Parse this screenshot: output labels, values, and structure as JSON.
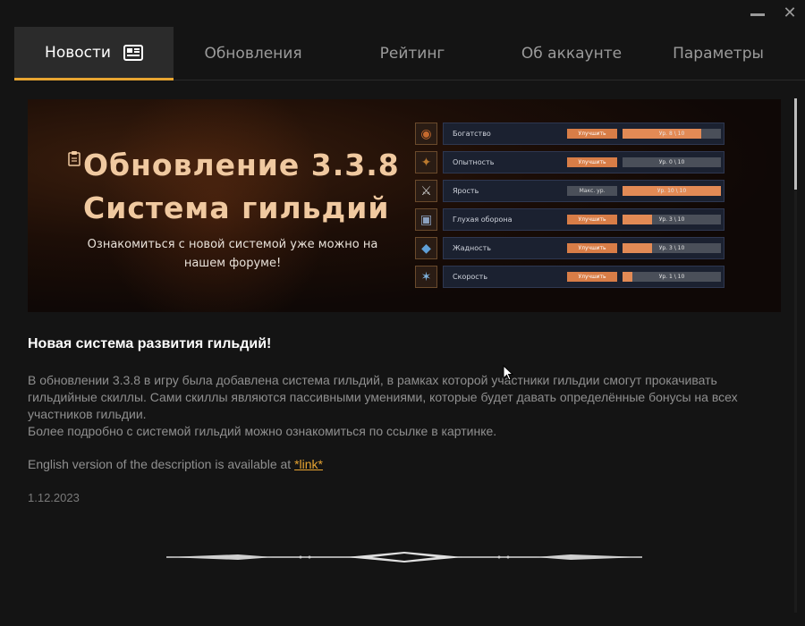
{
  "window": {
    "minimize_icon": "minimize-icon",
    "close_icon": "close-icon",
    "close_glyph": "✕"
  },
  "tabs": [
    {
      "label": "Новости",
      "active": true,
      "icon": "newspaper-icon"
    },
    {
      "label": "Обновления",
      "active": false
    },
    {
      "label": "Рейтинг",
      "active": false
    },
    {
      "label": "Об аккаунте",
      "active": false
    },
    {
      "label": "Параметры",
      "active": false
    }
  ],
  "banner": {
    "title_line1": "Обновление 3.3.8",
    "title_line2": "Система гильдий",
    "subtitle": "Ознакомиться с новой системой уже можно на нашем форуме!",
    "skills": [
      {
        "name": "Богатство",
        "button": "Улучшить",
        "level": "Ур. 8 \\ 10",
        "progress": 0.8,
        "icon": "coin-icon"
      },
      {
        "name": "Опытность",
        "button": "Улучшить",
        "level": "Ур. 0 \\ 10",
        "progress": 0.0,
        "icon": "star-icon"
      },
      {
        "name": "Ярость",
        "button": "Макс. ур.",
        "level": "Ур. 10 \\ 10",
        "progress": 1.0,
        "icon": "sword-icon"
      },
      {
        "name": "Глухая оборона",
        "button": "Улучшить",
        "level": "Ур. 3 \\ 10",
        "progress": 0.3,
        "icon": "shield-icon"
      },
      {
        "name": "Жадность",
        "button": "Улучшить",
        "level": "Ур. 3 \\ 10",
        "progress": 0.3,
        "icon": "crystal-icon"
      },
      {
        "name": "Скорость",
        "button": "Улучшить",
        "level": "Ур. 1 \\ 10",
        "progress": 0.1,
        "icon": "wind-icon"
      }
    ]
  },
  "article": {
    "title": "Новая система развития гильдий!",
    "paragraph1": "В обновлении 3.3.8 в игру была добавлена система гильдий, в рамках которой участники гильдии смогут прокачивать гильдийные скиллы. Сами скиллы являются пассивными умениями, которые будет давать определённые бонусы на всех участников гильдии.",
    "paragraph2": "Более подробно с системой гильдий можно ознакомиться по ссылке в картинке.",
    "english_prefix": "English version of the description is available at ",
    "english_link": "*link*",
    "date": "1.12.2023"
  },
  "colors": {
    "accent": "#e8a531",
    "background": "#141414",
    "active_tab": "#2b2b2b",
    "skill_fill": "#e28a55"
  }
}
